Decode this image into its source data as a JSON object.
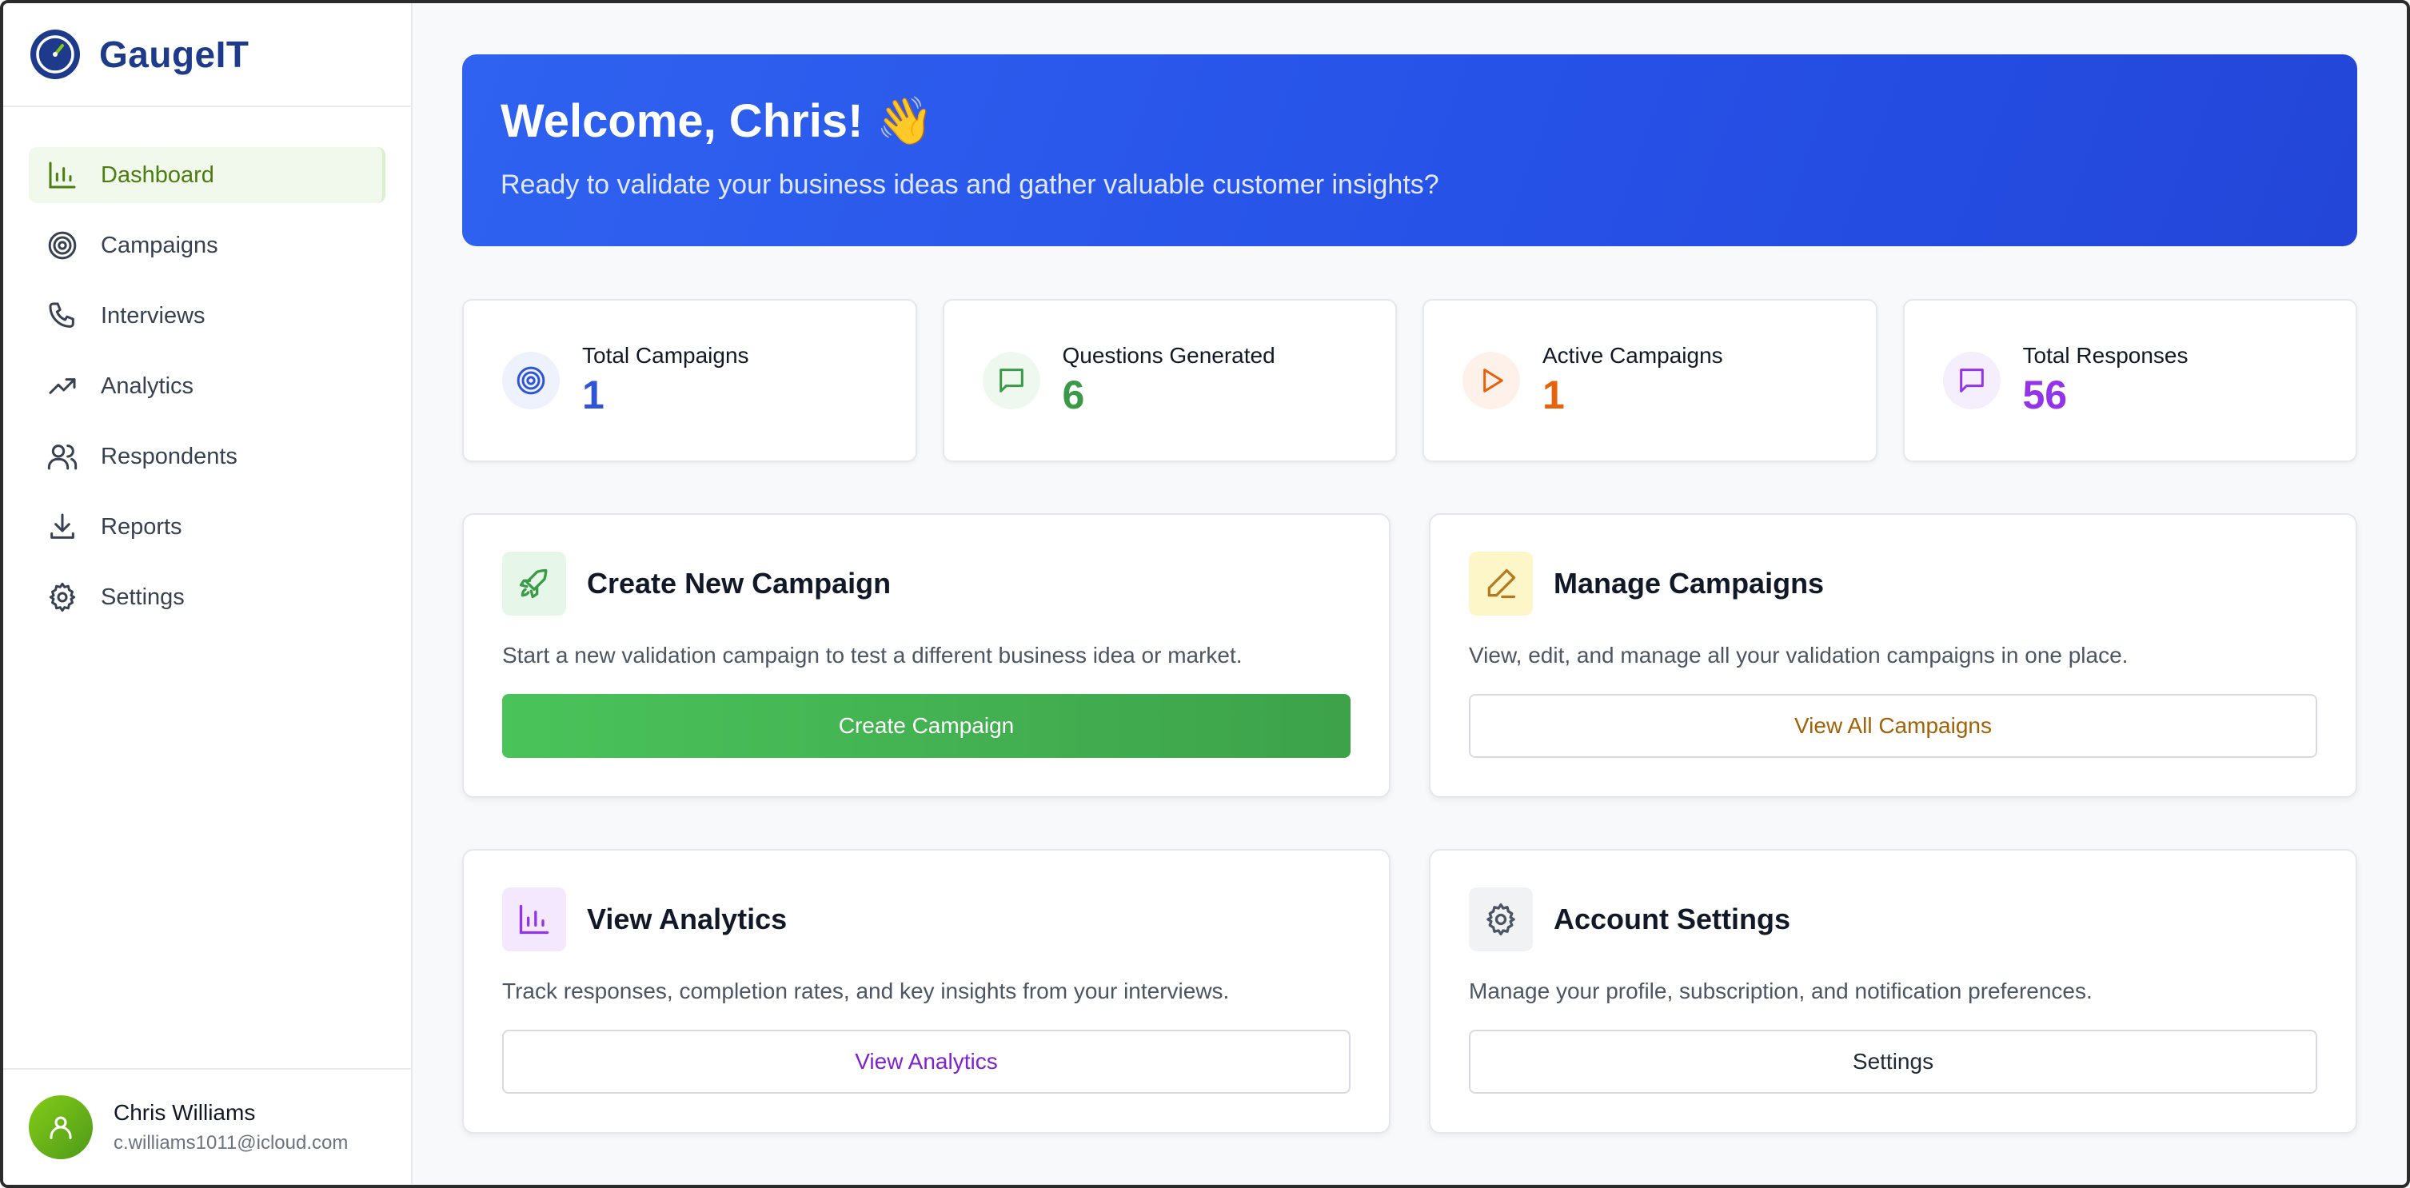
{
  "brand": {
    "name": "GaugeIT"
  },
  "nav": [
    {
      "label": "Dashboard",
      "icon": "bar-chart-icon",
      "active": true
    },
    {
      "label": "Campaigns",
      "icon": "target-icon"
    },
    {
      "label": "Interviews",
      "icon": "phone-icon"
    },
    {
      "label": "Analytics",
      "icon": "trending-up-icon"
    },
    {
      "label": "Respondents",
      "icon": "users-icon"
    },
    {
      "label": "Reports",
      "icon": "download-icon"
    },
    {
      "label": "Settings",
      "icon": "gear-icon"
    }
  ],
  "user": {
    "name": "Chris Williams",
    "email": "c.williams1011@icloud.com"
  },
  "hero": {
    "title": "Welcome, Chris! 👋",
    "subtitle": "Ready to validate your business ideas and gather valuable customer insights?"
  },
  "stats": [
    {
      "label": "Total Campaigns",
      "value": "1",
      "icon": "target-icon",
      "color": "#2f55d4"
    },
    {
      "label": "Questions Generated",
      "value": "6",
      "icon": "message-square-icon",
      "color": "#3a9a48"
    },
    {
      "label": "Active Campaigns",
      "value": "1",
      "icon": "play-icon",
      "color": "#e8620c"
    },
    {
      "label": "Total Responses",
      "value": "56",
      "icon": "message-square-icon",
      "color": "#9333ea"
    }
  ],
  "cards": [
    {
      "title": "Create New Campaign",
      "description": "Start a new validation campaign to test a different business idea or market.",
      "button": "Create Campaign",
      "icon": "rocket-icon"
    },
    {
      "title": "Manage Campaigns",
      "description": "View, edit, and manage all your validation campaigns in one place.",
      "button": "View All Campaigns",
      "icon": "pencil-icon"
    },
    {
      "title": "View Analytics",
      "description": "Track responses, completion rates, and key insights from your interviews.",
      "button": "View Analytics",
      "icon": "bar-chart-icon"
    },
    {
      "title": "Account Settings",
      "description": "Manage your profile, subscription, and notification preferences.",
      "button": "Settings",
      "icon": "gear-icon"
    }
  ],
  "colors": {
    "accent_green": "#4d7c0f",
    "hero_blue": "#2650e6",
    "brand_navy": "#1e3a8a"
  }
}
